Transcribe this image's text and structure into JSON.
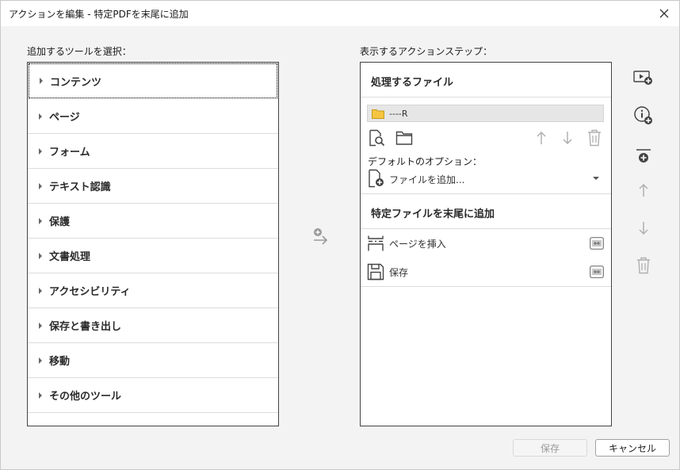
{
  "window": {
    "title": "アクションを編集 - 特定PDFを末尾に追加"
  },
  "left": {
    "heading": "追加するツールを選択：",
    "tools": [
      {
        "label": "コンテンツ"
      },
      {
        "label": "ページ"
      },
      {
        "label": "フォーム"
      },
      {
        "label": "テキスト認識"
      },
      {
        "label": "保護"
      },
      {
        "label": "文書処理"
      },
      {
        "label": "アクセシビリティ"
      },
      {
        "label": "保存と書き出し"
      },
      {
        "label": "移動"
      },
      {
        "label": "その他のツール"
      }
    ]
  },
  "right": {
    "heading": "表示するアクションステップ：",
    "files_section": {
      "title": "処理するファイル",
      "selected_file": "----R",
      "default_options_label": "デフォルトのオプション：",
      "add_files_value": "ファイルを追加..."
    },
    "append_section": {
      "title": "特定ファイルを末尾に追加",
      "steps": [
        {
          "label": "ページを挿入",
          "icon": "insert-pages-icon"
        },
        {
          "label": "保存",
          "icon": "save-disk-icon"
        }
      ]
    }
  },
  "footer": {
    "save_label": "保存",
    "cancel_label": "キャンセル"
  },
  "colors": {
    "folder": "#f5c542",
    "icon_gray": "#555555",
    "disabled_gray": "#b0b0b0"
  }
}
